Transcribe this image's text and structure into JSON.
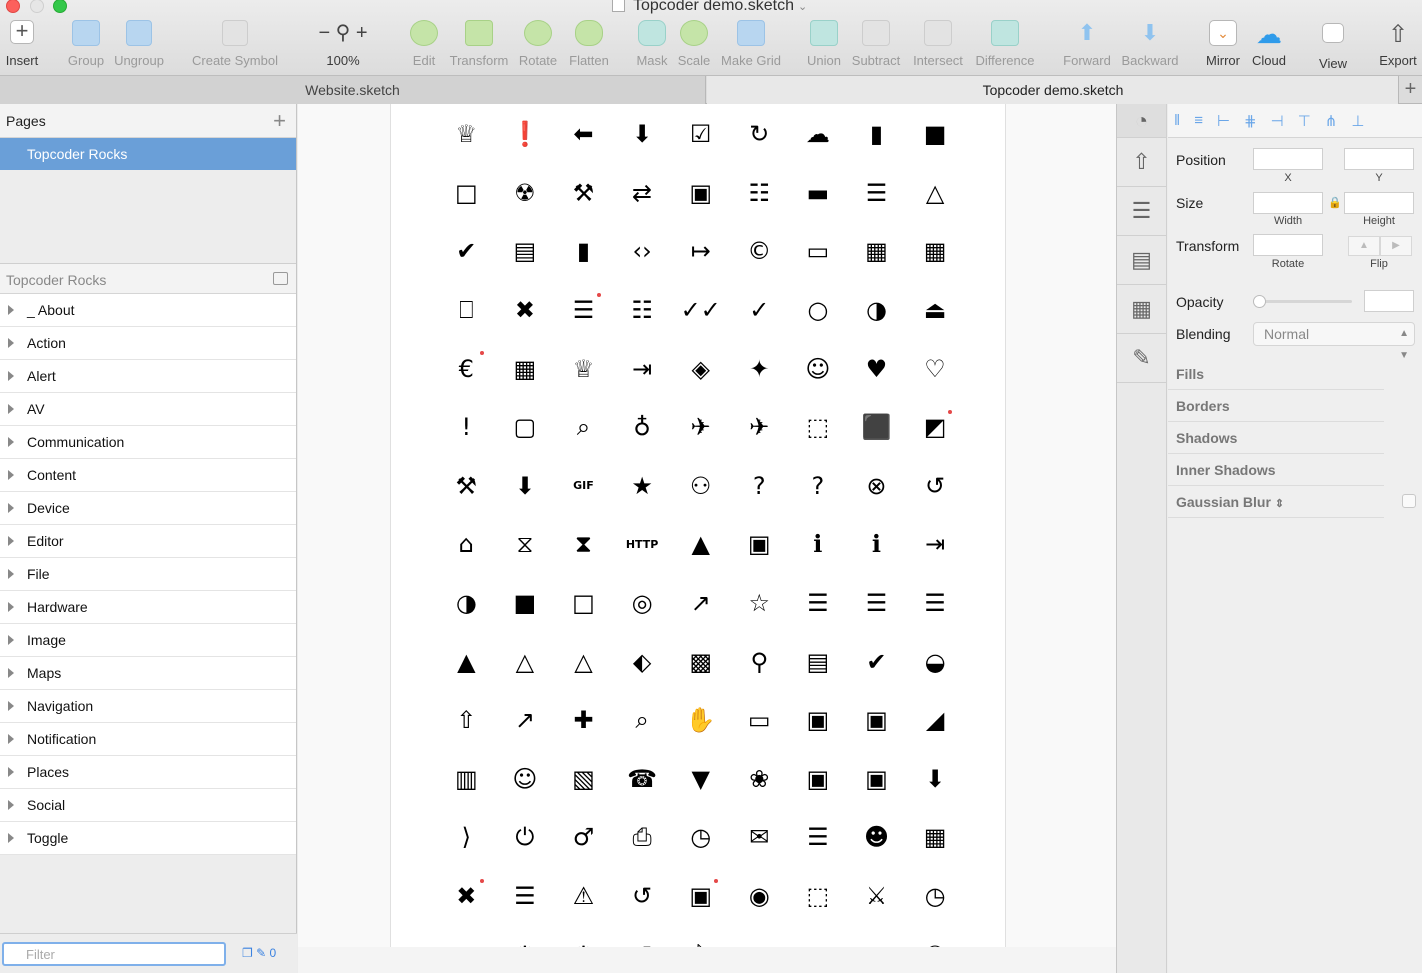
{
  "window": {
    "title": "Topcoder demo.sketch"
  },
  "toolbar": {
    "insert": "Insert",
    "group": "Group",
    "ungroup": "Ungroup",
    "create_symbol": "Create Symbol",
    "zoom": "100%",
    "edit": "Edit",
    "transform": "Transform",
    "rotate": "Rotate",
    "flatten": "Flatten",
    "mask": "Mask",
    "scale": "Scale",
    "make_grid": "Make Grid",
    "union": "Union",
    "subtract": "Subtract",
    "intersect": "Intersect",
    "difference": "Difference",
    "forward": "Forward",
    "backward": "Backward",
    "mirror": "Mirror",
    "cloud": "Cloud",
    "view": "View",
    "export": "Export"
  },
  "tabs": [
    "Website.sketch",
    "Topcoder demo.sketch"
  ],
  "sidebar": {
    "pages_title": "Pages",
    "pages": [
      "Topcoder Rocks"
    ],
    "layers_title": "Topcoder Rocks",
    "layers": [
      "_ About",
      "Action",
      "Alert",
      "AV",
      "Communication",
      "Content",
      "Device",
      "Editor",
      "File",
      "Hardware",
      "Image",
      "Maps",
      "Navigation",
      "Notification",
      "Places",
      "Social",
      "Toggle"
    ],
    "filter_placeholder": "Filter",
    "filter_count": "0"
  },
  "canvas": {
    "icons": [
      "♕",
      "❗",
      "⬅",
      "⬇",
      "☑",
      "↻",
      "☁",
      "▮",
      "■",
      "□",
      "☢",
      "⚒",
      "⇄",
      "▣",
      "☷",
      "▬",
      "☰",
      "△",
      "✔",
      "▤",
      "▮",
      "‹›",
      "↦",
      "©",
      "▭",
      "▦",
      "▦",
      "⎕",
      "✖",
      "☰",
      "☷",
      "✓✓",
      "✓",
      "○",
      "◑",
      "⏏",
      "€",
      "▦",
      "♕",
      "⇥",
      "◈",
      "✦",
      "☺",
      "♥",
      "♡",
      "!",
      "▢",
      "⌕",
      "♁",
      "✈",
      "✈",
      "⬚",
      "⬛",
      "◩",
      "⚒",
      "⬇",
      "GIF",
      "★",
      "⚇",
      "?",
      "?",
      "⊗",
      "↺",
      "⌂",
      "⧖",
      "⧗",
      "HTTP",
      "▲",
      "▣",
      "ℹ",
      "ℹ",
      "⇥",
      "◑",
      "■",
      "□",
      "◎",
      "↗",
      "☆",
      "☰",
      "☰",
      "☰",
      "▲",
      "△",
      "△",
      "⬖",
      "▩",
      "⚲",
      "▤",
      "✔",
      "◒",
      "⇧",
      "↗",
      "✚",
      "⌕",
      "✋",
      "▭",
      "▣",
      "▣",
      "◢",
      "▥",
      "☺",
      "▧",
      "☎",
      "▼",
      "❀",
      "▣",
      "▣",
      "⬇",
      "⟩",
      "⏻",
      "♂",
      "⎙",
      "◷",
      "✉",
      "☰",
      "☻",
      "▦",
      "✖",
      "☰",
      "⚠",
      "↺",
      "▣",
      "◉",
      "⬚",
      "⚔",
      "◷",
      "⌕",
      "⚙",
      "⚙",
      "↺",
      "ᛒ",
      "▣",
      "▯",
      "↔",
      "⚇"
    ]
  },
  "inspector": {
    "position": "Position",
    "x": "X",
    "y": "Y",
    "size": "Size",
    "width": "Width",
    "height": "Height",
    "transform": "Transform",
    "rotate": "Rotate",
    "flip": "Flip",
    "opacity": "Opacity",
    "blending": "Blending",
    "blending_value": "Normal",
    "fills": "Fills",
    "borders": "Borders",
    "shadows": "Shadows",
    "inner_shadows": "Inner Shadows",
    "gaussian_blur": "Gaussian Blur"
  }
}
